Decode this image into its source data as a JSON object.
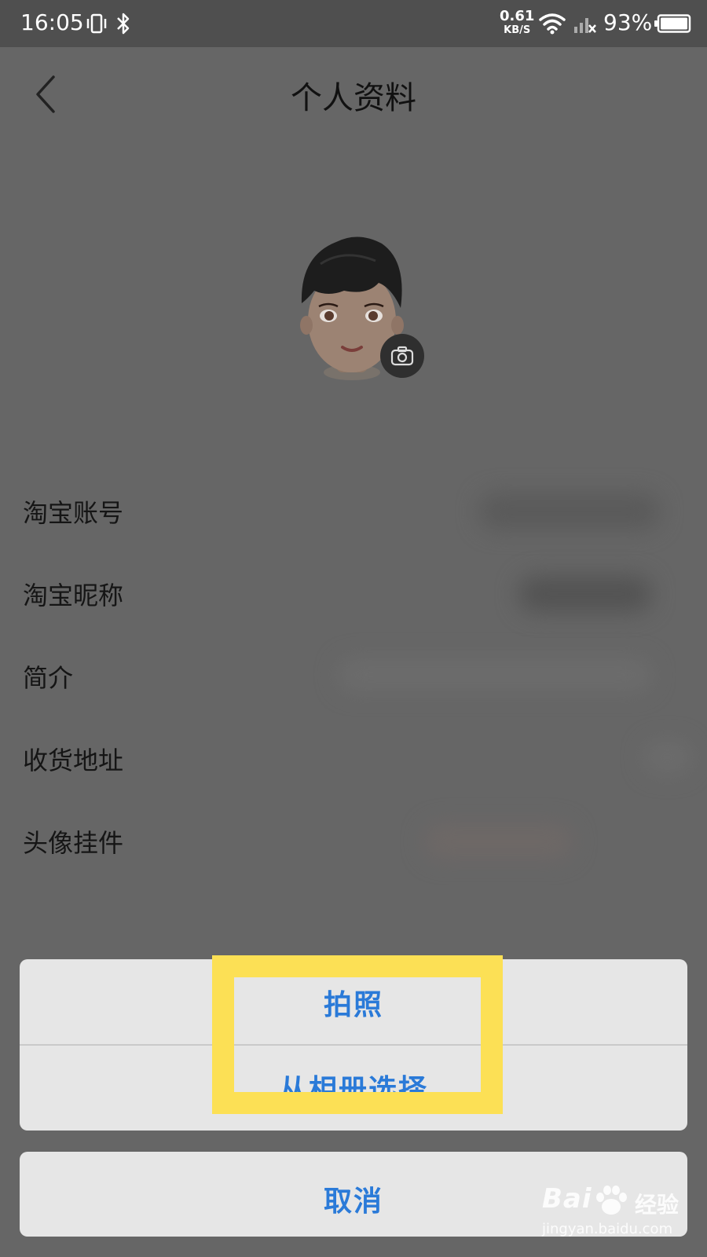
{
  "status_bar": {
    "time": "16:05",
    "net_speed_value": "0.61",
    "net_speed_unit": "KB/S",
    "battery_percent": "93%"
  },
  "header": {
    "title": "个人资料"
  },
  "rows": [
    {
      "label": "淘宝账号"
    },
    {
      "label": "淘宝昵称"
    },
    {
      "label": "简介"
    },
    {
      "label": "收货地址"
    },
    {
      "label": "头像挂件"
    }
  ],
  "sheet": {
    "take_photo_label": "拍照",
    "choose_album_label": "从相册选择",
    "cancel_label": "取消",
    "action_color": "#2a7ad8"
  },
  "overlay": {
    "highlight_color": "#fce055"
  },
  "watermark": {
    "brand": "Bai",
    "brand_suffix": "经验",
    "url": "jingyan.baidu.com"
  }
}
